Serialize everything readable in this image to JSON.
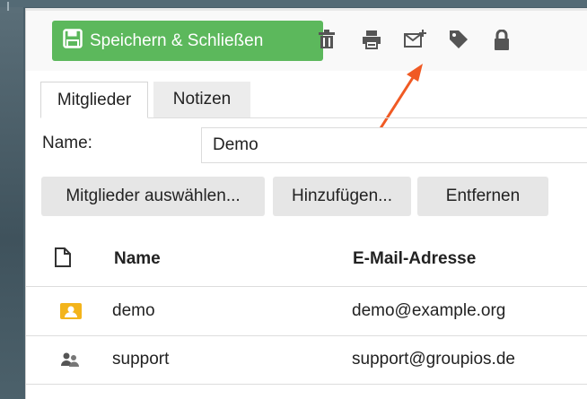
{
  "toolbar": {
    "save_label": "Speichern & Schließen",
    "save_color": "#5cb85c",
    "icons": [
      "trash-icon",
      "print-icon",
      "mail-add-icon",
      "tag-icon",
      "lock-icon"
    ],
    "annotation_color": "#f05a24"
  },
  "tabs": [
    {
      "label": "Mitglieder",
      "active": true
    },
    {
      "label": "Notizen",
      "active": false
    }
  ],
  "form": {
    "name_label": "Name:",
    "name_value": "Demo"
  },
  "actions": {
    "select_label": "Mitglieder auswählen...",
    "add_label": "Hinzufügen...",
    "remove_label": "Entfernen"
  },
  "table": {
    "columns": [
      "Name",
      "E-Mail-Adresse"
    ],
    "rows": [
      {
        "icon": "contact-card-icon",
        "name": "demo",
        "email": "demo@example.org"
      },
      {
        "icon": "group-icon",
        "name": "support",
        "email": "support@groupios.de"
      }
    ]
  }
}
